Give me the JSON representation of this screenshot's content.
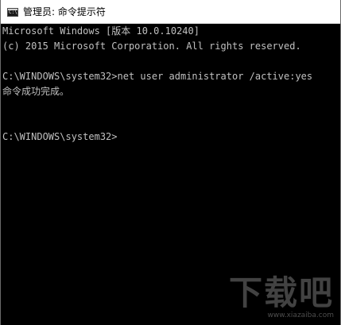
{
  "window": {
    "title": "管理员: 命令提示符"
  },
  "console": {
    "lines": [
      "Microsoft Windows [版本 10.0.10240]",
      "(c) 2015 Microsoft Corporation. All rights reserved.",
      "",
      "C:\\WINDOWS\\system32>net user administrator /active:yes",
      "命令成功完成。",
      "",
      "",
      "C:\\WINDOWS\\system32>"
    ]
  },
  "watermark": {
    "logo_text": "下载吧",
    "url": "www.xiazaiba.com"
  }
}
